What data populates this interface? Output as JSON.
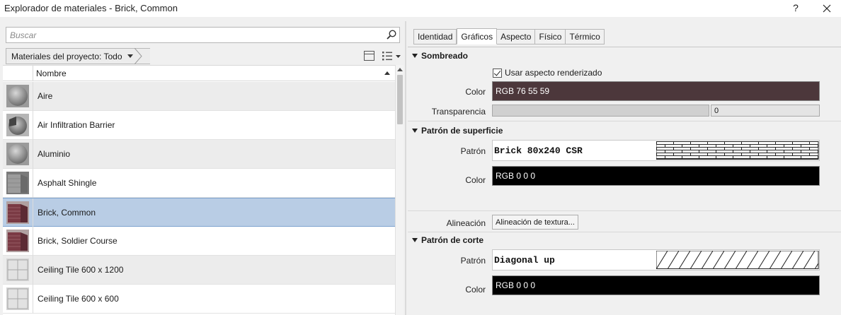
{
  "window": {
    "title": "Explorador de materiales - Brick, Common",
    "help_label": "?"
  },
  "browser": {
    "search_placeholder": "Buscar",
    "filter_label": "Materiales del proyecto: Todo",
    "column_name": "Nombre",
    "items": [
      {
        "name": "Aire",
        "thumb": "sphere-grey"
      },
      {
        "name": "Air Infiltration Barrier",
        "thumb": "sphere-cut"
      },
      {
        "name": "Aluminio",
        "thumb": "sphere-grey"
      },
      {
        "name": "Asphalt Shingle",
        "thumb": "block-grey"
      },
      {
        "name": "Brick, Common",
        "thumb": "block-brick"
      },
      {
        "name": "Brick, Soldier Course",
        "thumb": "block-brick"
      },
      {
        "name": "Ceiling Tile 600 x 1200",
        "thumb": "tile-light"
      },
      {
        "name": "Ceiling Tile 600 x 600",
        "thumb": "tile-light"
      }
    ],
    "selected_index": 4
  },
  "tabs": [
    {
      "label": "Identidad",
      "active": false
    },
    {
      "label": "Gráficos",
      "active": true
    },
    {
      "label": "Aspecto",
      "active": false
    },
    {
      "label": "Físico",
      "active": false
    },
    {
      "label": "Térmico",
      "active": false
    }
  ],
  "graphics": {
    "shading": {
      "title": "Sombreado",
      "use_render_label": "Usar aspecto renderizado",
      "use_render_checked": true,
      "color_label": "Color",
      "color_value": "RGB 76 55 59",
      "color_hex": "#4c373b",
      "transparency_label": "Transparencia",
      "transparency_value": "0"
    },
    "surface": {
      "title": "Patrón de superficie",
      "pattern_label": "Patrón",
      "pattern_value": "Brick 80x240 CSR",
      "color_label": "Color",
      "color_value": "RGB 0 0 0",
      "color_hex": "#000000",
      "alignment_label": "Alineación",
      "alignment_button": "Alineación de textura..."
    },
    "cut": {
      "title": "Patrón de corte",
      "pattern_label": "Patrón",
      "pattern_value": "Diagonal up",
      "color_label": "Color",
      "color_value": "RGB 0 0 0",
      "color_hex": "#000000"
    }
  }
}
